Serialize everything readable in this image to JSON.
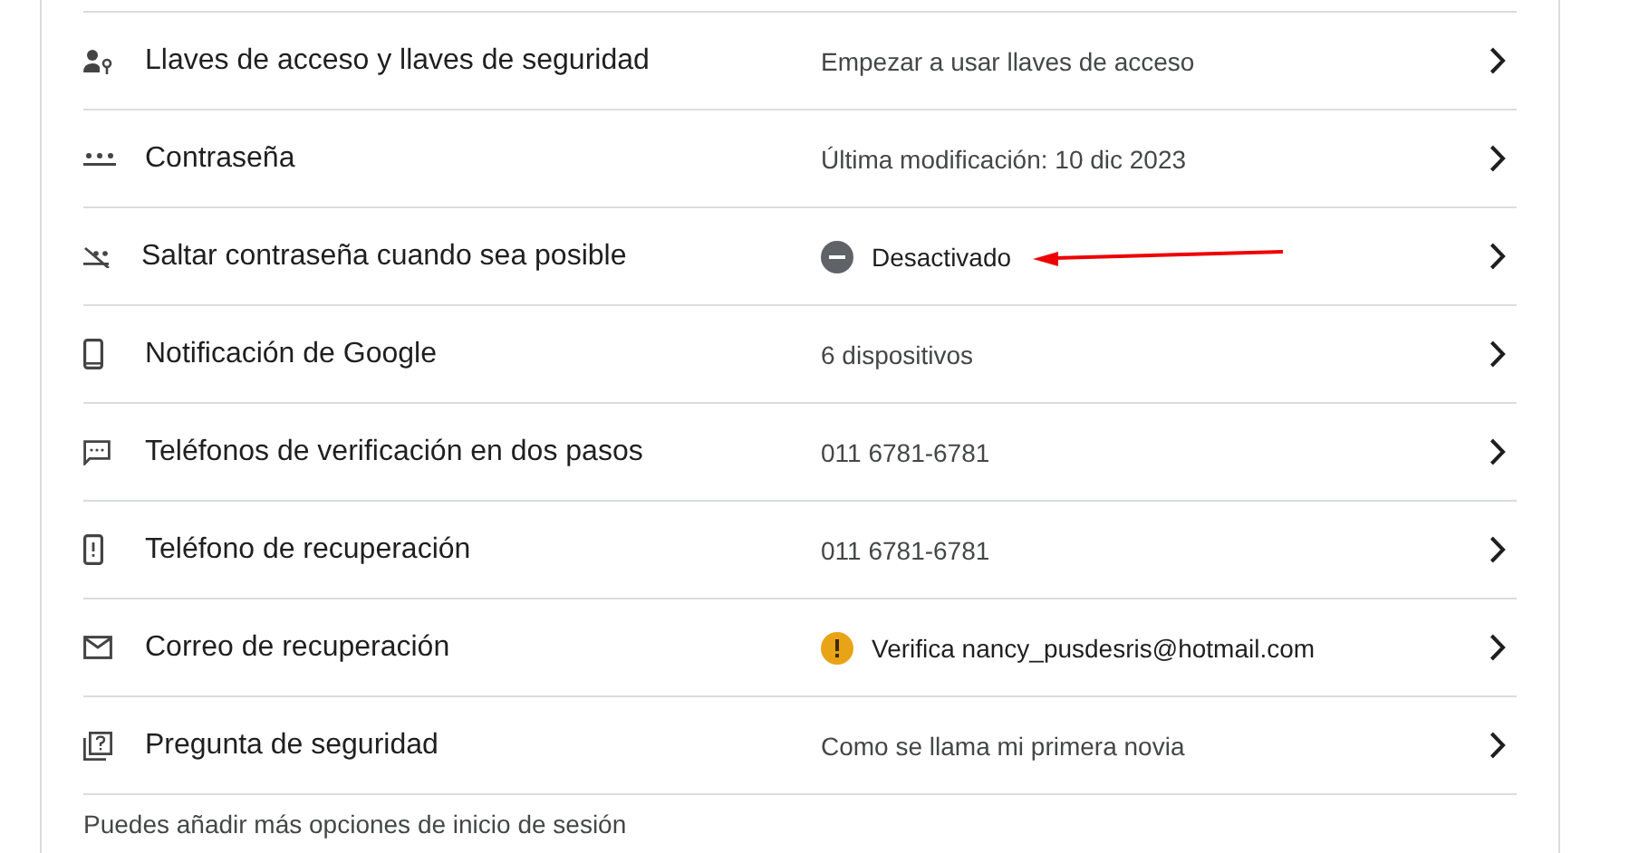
{
  "rows": [
    {
      "kind": "passkey",
      "label": "Llaves de acceso y llaves de seguridad",
      "value": "Empezar a usar llaves de acceso"
    },
    {
      "kind": "password",
      "label": "Contraseña",
      "value": "Última modificación: 10 dic 2023"
    },
    {
      "kind": "skip",
      "label": "Saltar contraseña cuando sea posible",
      "value": "Desactivado",
      "status": {
        "kind": "off"
      }
    },
    {
      "kind": "phone",
      "label": "Notificación de Google",
      "value": "6 dispositivos"
    },
    {
      "kind": "sms",
      "label": "Teléfonos de verificación en dos pasos",
      "value": "011 6781-6781"
    },
    {
      "kind": "recovery-phone",
      "label": "Teléfono de recuperación",
      "value": "011 6781-6781"
    },
    {
      "kind": "email",
      "label": "Correo de recuperación",
      "value": "Verifica nancy_pusdesris@hotmail.com",
      "status": {
        "kind": "warning"
      }
    },
    {
      "kind": "question",
      "label": "Pregunta de seguridad",
      "value": "Como se llama mi primera novia"
    }
  ],
  "footer": "Puedes añadir más opciones de inicio de sesión"
}
